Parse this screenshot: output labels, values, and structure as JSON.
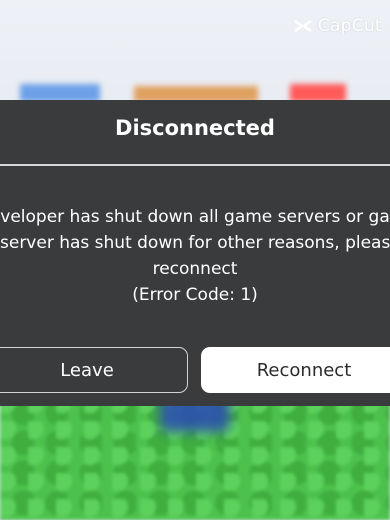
{
  "watermark": {
    "text": "CapCut"
  },
  "dialog": {
    "title": "Disconnected",
    "message_lines": [
      "veloper has shut down all game servers or ga",
      "server has shut down for other reasons, please",
      "reconnect",
      "(Error Code: 1)"
    ],
    "buttons": {
      "leave": "Leave",
      "reconnect": "Reconnect"
    }
  },
  "colors": {
    "dialog_bg": "#393b3d",
    "grass": "#4cc24c",
    "primary_button": "#ffffff"
  }
}
